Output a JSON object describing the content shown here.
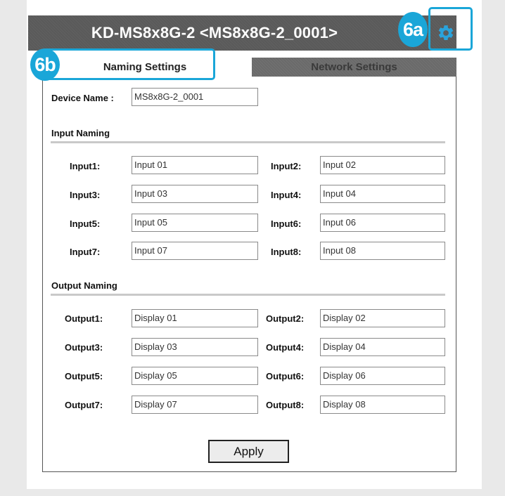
{
  "window": {
    "title": "KD-MS8x8G-2 <MS8x8G-2_0001>"
  },
  "tabs": {
    "naming": "Naming Settings",
    "network": "Network Settings"
  },
  "device": {
    "label": "Device Name :",
    "value": "MS8x8G-2_0001"
  },
  "input_naming": {
    "heading": "Input Naming",
    "rows": [
      {
        "label": "Input1:",
        "value": "Input 01"
      },
      {
        "label": "Input2:",
        "value": "Input 02"
      },
      {
        "label": "Input3:",
        "value": "Input 03"
      },
      {
        "label": "Input4:",
        "value": "Input 04"
      },
      {
        "label": "Input5:",
        "value": "Input 05"
      },
      {
        "label": "Input6:",
        "value": "Input 06"
      },
      {
        "label": "Input7:",
        "value": "Input 07"
      },
      {
        "label": "Input8:",
        "value": "Input 08"
      }
    ]
  },
  "output_naming": {
    "heading": "Output Naming",
    "rows": [
      {
        "label": "Output1:",
        "value": "Display 01"
      },
      {
        "label": "Output2:",
        "value": "Display 02"
      },
      {
        "label": "Output3:",
        "value": "Display 03"
      },
      {
        "label": "Output4:",
        "value": "Display 04"
      },
      {
        "label": "Output5:",
        "value": "Display 05"
      },
      {
        "label": "Output6:",
        "value": "Display 06"
      },
      {
        "label": "Output7:",
        "value": "Display 07"
      },
      {
        "label": "Output8:",
        "value": "Display 08"
      }
    ]
  },
  "apply_label": "Apply",
  "callouts": {
    "settings_gear": "6a",
    "naming_tab": "6b"
  },
  "icons": {
    "settings": "gear-icon"
  },
  "colors": {
    "callout": "#1aa6d8",
    "titlebar": "#5a5a5a",
    "gear": "#2aa3dc"
  }
}
